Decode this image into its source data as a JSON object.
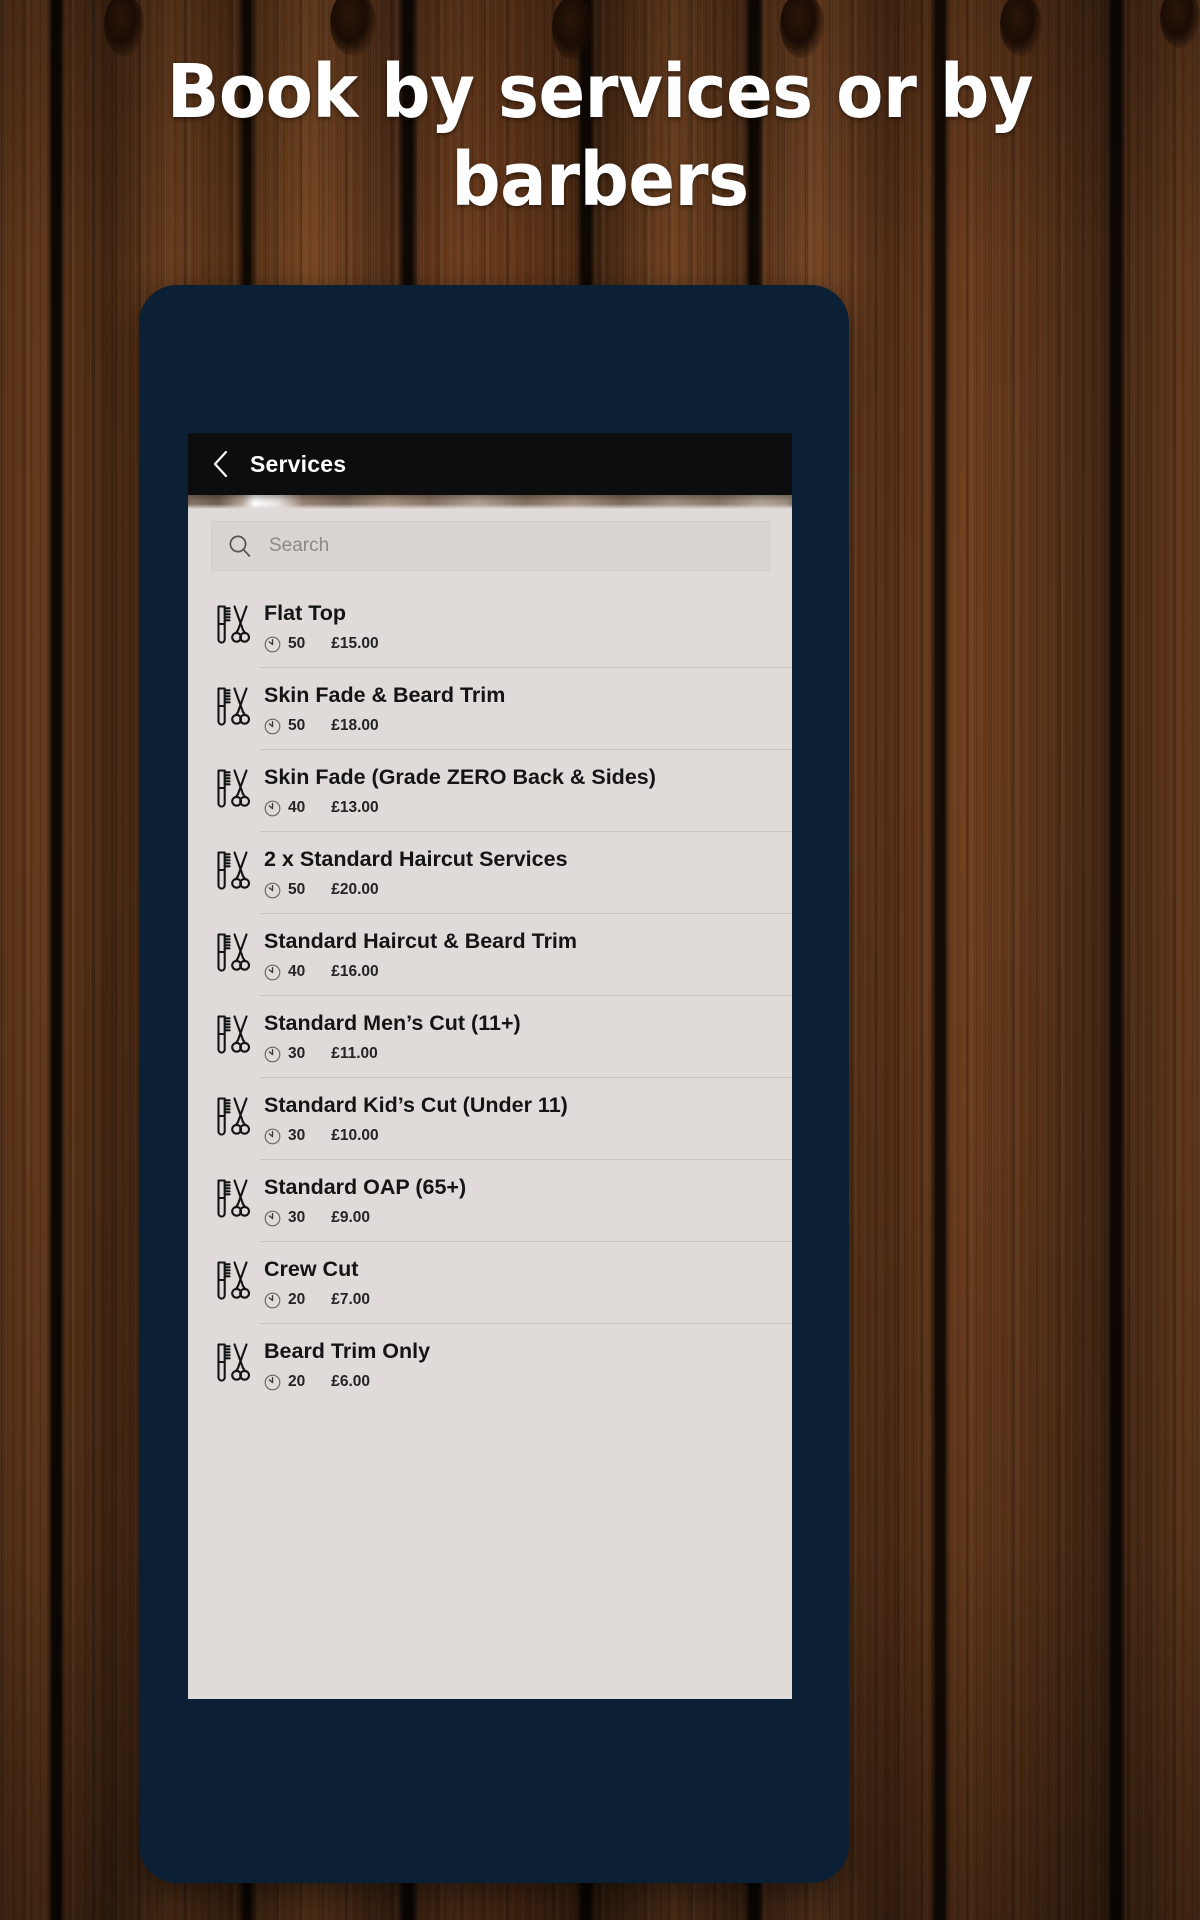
{
  "promo": {
    "headline": "Book by services or by barbers"
  },
  "app": {
    "header": {
      "back_icon": "chevron-left-icon",
      "title": "Services"
    },
    "search": {
      "icon": "search-icon",
      "placeholder": "Search",
      "value": ""
    },
    "list": {
      "service_icon": "comb-and-scissors-icon",
      "duration_icon": "clock-icon",
      "items": [
        {
          "name": "Flat Top",
          "duration": "50",
          "price": "£15.00"
        },
        {
          "name": "Skin Fade & Beard Trim",
          "duration": "50",
          "price": "£18.00"
        },
        {
          "name": "Skin Fade (Grade ZERO Back & Sides)",
          "duration": "40",
          "price": "£13.00"
        },
        {
          "name": "2 x Standard Haircut Services",
          "duration": "50",
          "price": "£20.00"
        },
        {
          "name": "Standard Haircut & Beard Trim",
          "duration": "40",
          "price": "£16.00"
        },
        {
          "name": "Standard Men’s Cut (11+)",
          "duration": "30",
          "price": "£11.00"
        },
        {
          "name": "Standard Kid’s Cut (Under 11)",
          "duration": "30",
          "price": "£10.00"
        },
        {
          "name": "Standard OAP (65+)",
          "duration": "30",
          "price": "£9.00"
        },
        {
          "name": "Crew Cut",
          "duration": "20",
          "price": "£7.00"
        },
        {
          "name": "Beard Trim Only",
          "duration": "20",
          "price": "£6.00"
        }
      ]
    }
  },
  "colors": {
    "device_frame": "#0b2034",
    "app_bar": "#0d0d0d",
    "list_background": "#e0dbd9",
    "search_field": "#dad5d3",
    "separator": "#c9c3c0",
    "headline_text": "#ffffff",
    "wood_background": "#5c3519"
  }
}
